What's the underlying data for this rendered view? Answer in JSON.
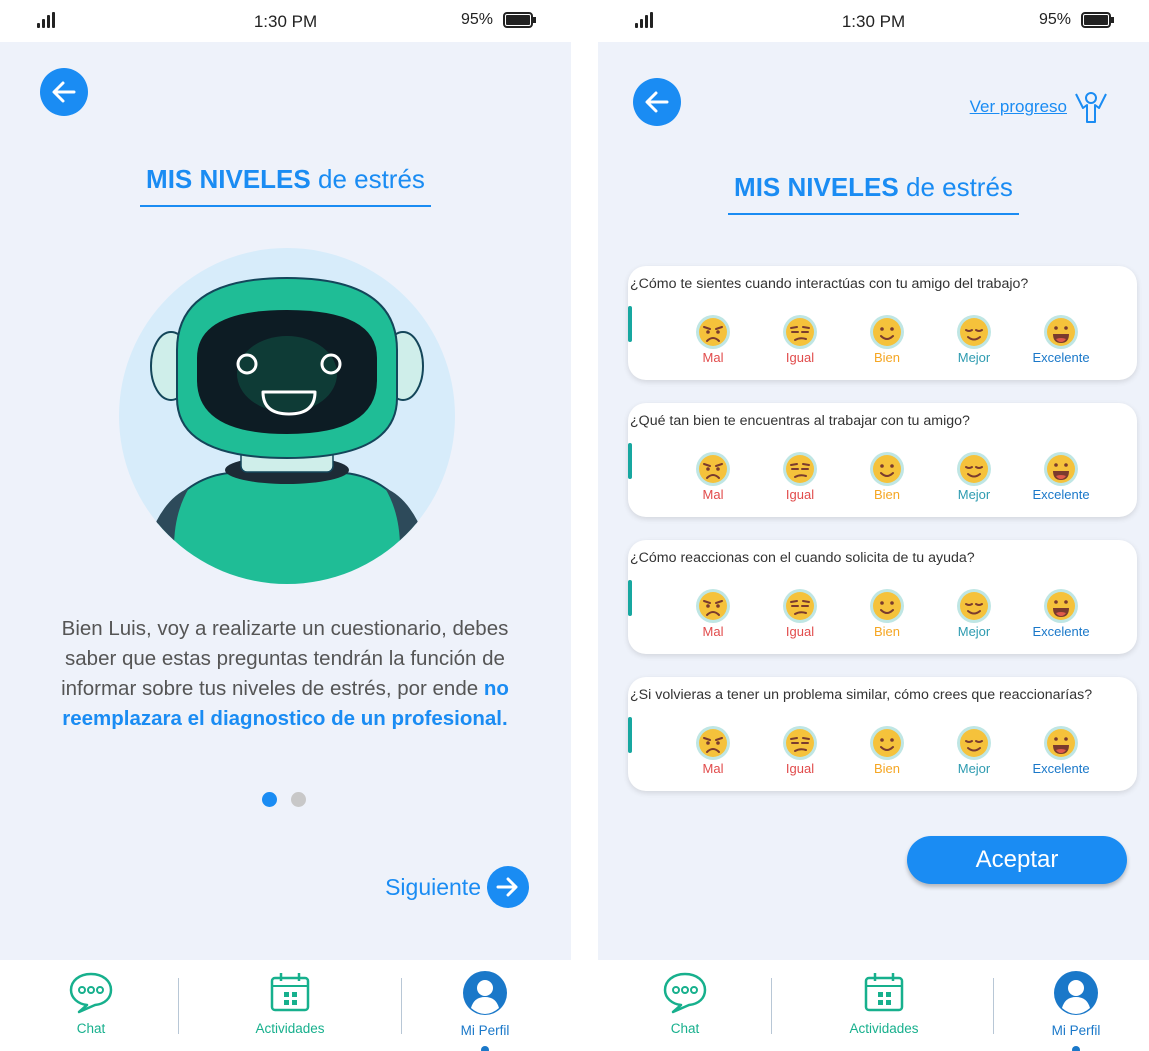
{
  "status": {
    "time": "1:30 PM",
    "battery": "95%"
  },
  "left_screen": {
    "title_bold": "MIS NIVELES",
    "title_rest": "de estrés",
    "intro_text": "Bien Luis, voy a realizarte un cuestionario, debes saber que estas preguntas tendrán la función de informar sobre tus niveles de estrés, por ende",
    "intro_highlight": "no reemplazara el diagnostico de un profesional.",
    "pager": {
      "current": 1,
      "total": 2
    },
    "next_label": "Siguiente"
  },
  "right_screen": {
    "progress_link": "Ver progreso",
    "title_bold": "MIS NIVELES",
    "title_rest": "de estrés",
    "questions": [
      "¿Cómo te sientes cuando interactúas con tu amigo del trabajo?",
      "¿Qué tan bien te encuentras  al trabajar con tu amigo?",
      "¿Cómo reaccionas con el cuando solicita de tu ayuda?",
      "¿Si volvieras a tener un problema similar, cómo crees que reaccionarías?"
    ],
    "options": [
      {
        "label": "Mal",
        "color": "#e14b4b",
        "icon": "angry-face-icon"
      },
      {
        "label": "Igual",
        "color": "#e14b4b",
        "icon": "unamused-face-icon"
      },
      {
        "label": "Bien",
        "color": "#f5a623",
        "icon": "smiling-face-icon"
      },
      {
        "label": "Mejor",
        "color": "#2d9bb0",
        "icon": "relieved-face-icon"
      },
      {
        "label": "Excelente",
        "color": "#1a78c9",
        "icon": "grinning-face-icon"
      }
    ],
    "accept_label": "Aceptar"
  },
  "nav": {
    "chat": "Chat",
    "activities": "Actividades",
    "profile": "Mi Perfil"
  },
  "colors": {
    "primary": "#1a8cf3",
    "teal": "#17b08d",
    "background": "#eef2fa"
  }
}
